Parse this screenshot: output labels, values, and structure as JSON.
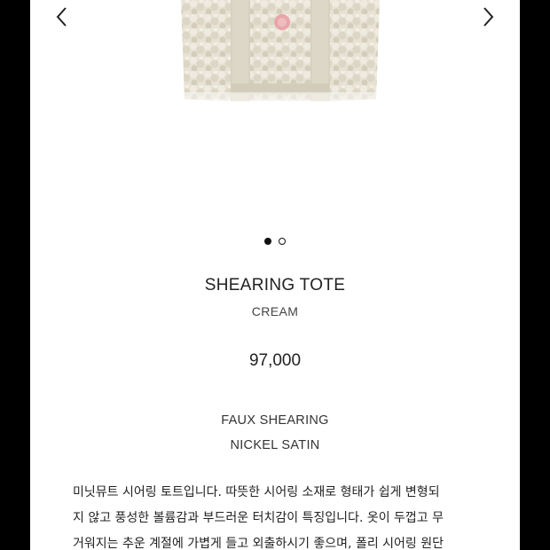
{
  "product": {
    "name": "SHEARING TOTE",
    "color": "CREAM",
    "price": "97,000",
    "materials": [
      "FAUX SHEARING",
      "NICKEL SATIN"
    ]
  },
  "gallery": {
    "prev_icon": "chevron-left-icon",
    "next_icon": "chevron-right-icon",
    "page_count": 2,
    "current_page": 1
  },
  "description": {
    "lines": [
      "미닛뮤트 시어링 토트입니다. 따뜻한 시어링 소재로 형태가 쉽게 변형되",
      "지 않고 풍성한 볼륨감과 부드러운 터치감이 특징입니다. 옷이 두껍고 무",
      "거워지는 추운 계절에 가볍게 들고 외출하시기 좋으며, 폴리 시어링 원단"
    ]
  },
  "colors": {
    "background": "#ffffff",
    "frame": "#000000",
    "text": "#222222",
    "shearing": "#e6e1d3",
    "strap": "#d8d3c2",
    "button": "#e8a6aa"
  }
}
